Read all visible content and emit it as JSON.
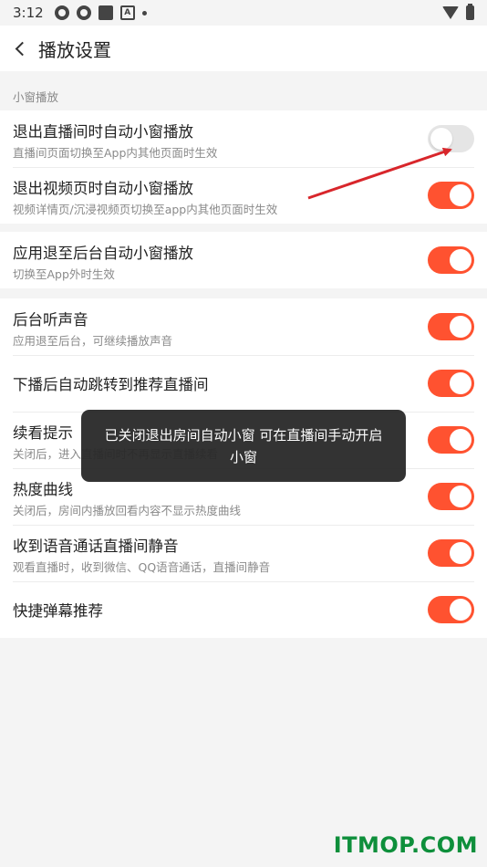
{
  "status_bar": {
    "time": "3:12"
  },
  "header": {
    "title": "播放设置"
  },
  "section_label": "小窗播放",
  "group1": [
    {
      "title": "退出直播间时自动小窗播放",
      "subtitle": "直播间页面切换至App内其他页面时生效",
      "on": false
    },
    {
      "title": "退出视频页时自动小窗播放",
      "subtitle": "视频详情页/沉浸视频页切换至app内其他页面时生效",
      "on": true
    }
  ],
  "group2": [
    {
      "title": "应用退至后台自动小窗播放",
      "subtitle": "切换至App外时生效",
      "on": true
    }
  ],
  "group3": [
    {
      "title": "后台听声音",
      "subtitle": "应用退至后台，可继续播放声音",
      "on": true
    },
    {
      "title": "下播后自动跳转到推荐直播间",
      "subtitle": "",
      "on": true
    },
    {
      "title": "续看提示",
      "subtitle": "关闭后，进入直播间时不再显示直播续看",
      "on": true
    },
    {
      "title": "热度曲线",
      "subtitle": "关闭后，房间内播放回看内容不显示热度曲线",
      "on": true
    },
    {
      "title": "收到语音通话直播间静音",
      "subtitle": "观看直播时，收到微信、QQ语音通话，直播间静音",
      "on": true
    },
    {
      "title": "快捷弹幕推荐",
      "subtitle": "",
      "on": true
    }
  ],
  "toast": {
    "line1": "已关闭退出房间自动小窗 可在直播间手动开启",
    "line2": "小窗"
  },
  "watermark": "ITMOP.COM",
  "colors": {
    "accent": "#ff5230",
    "toggle_off": "#e5e5e5",
    "annotation_arrow": "#d8262b",
    "watermark": "#0e8f3b"
  }
}
